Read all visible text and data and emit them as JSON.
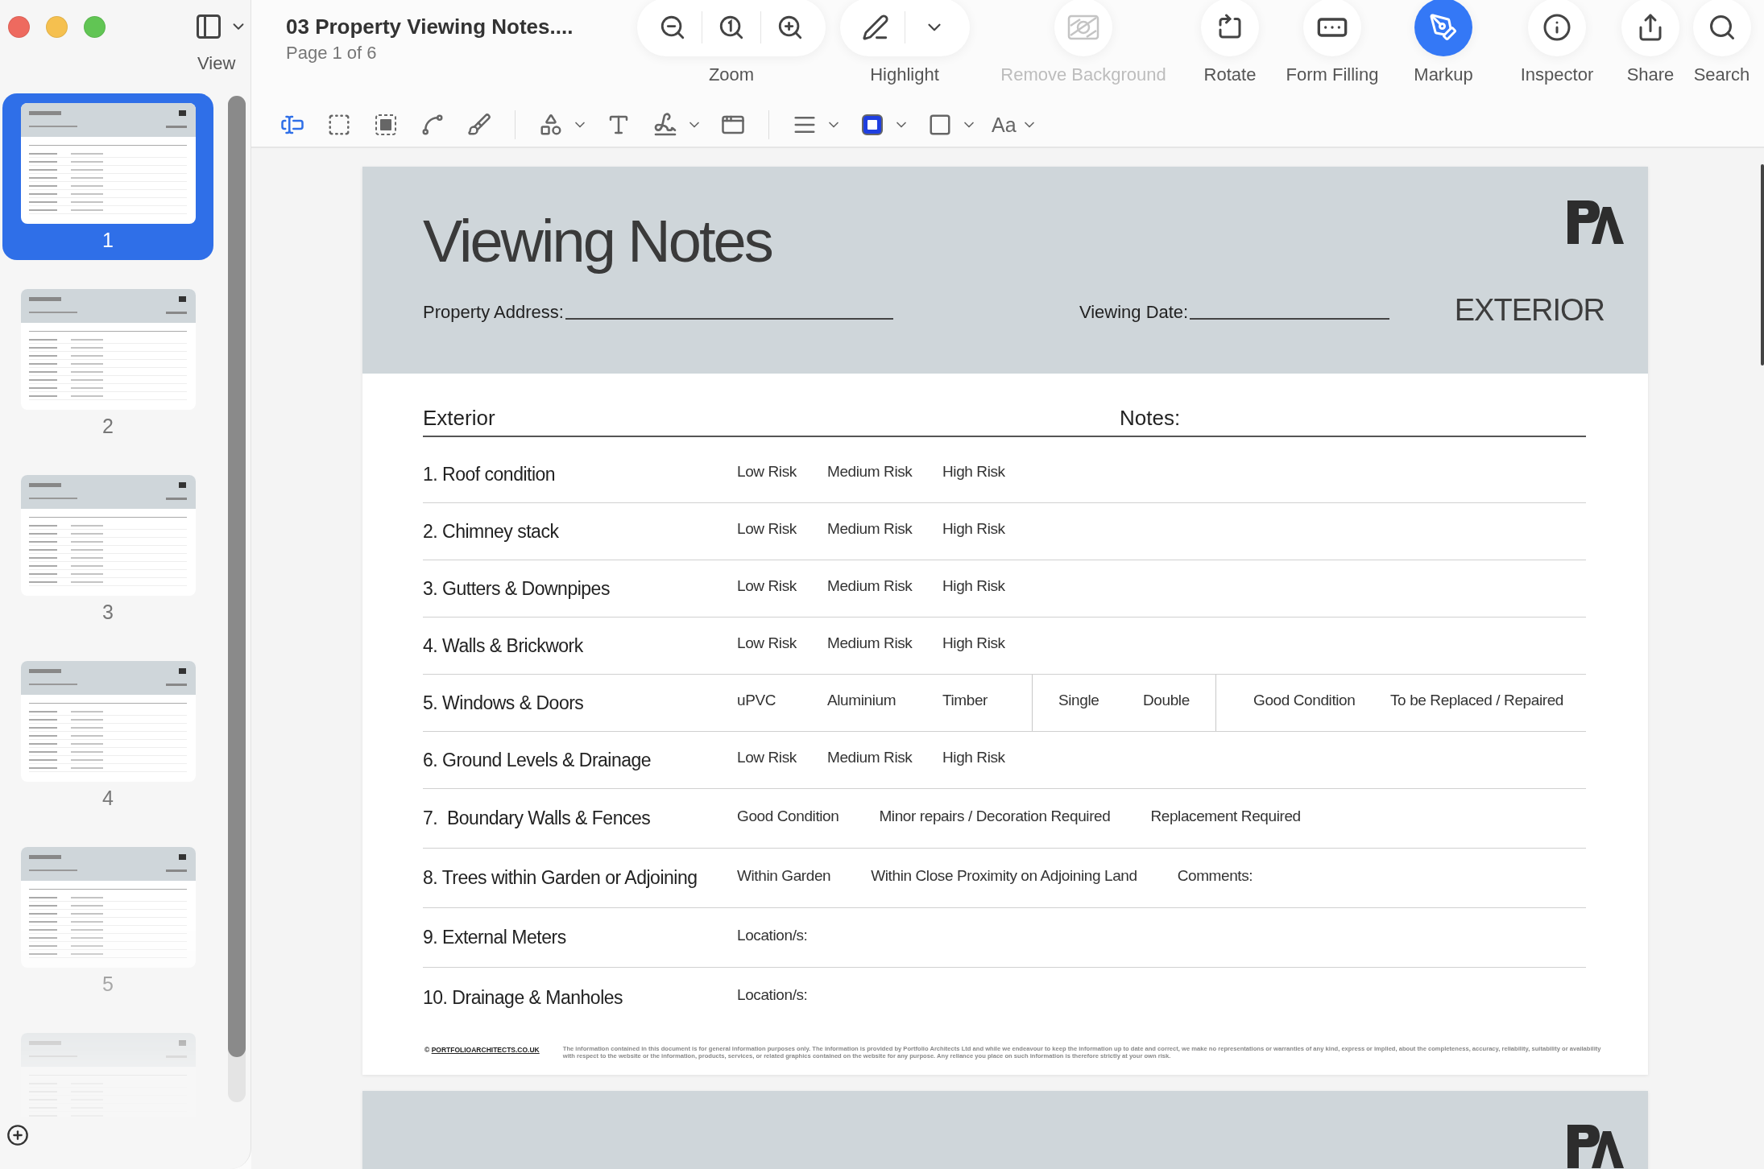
{
  "window": {
    "title": "03 Property Viewing Notes....",
    "subtitle": "Page 1 of 6"
  },
  "sidebar": {
    "view_label": "View",
    "pages": [
      {
        "number": "1",
        "selected": true
      },
      {
        "number": "2",
        "selected": false
      },
      {
        "number": "3",
        "selected": false
      },
      {
        "number": "4",
        "selected": false
      },
      {
        "number": "5",
        "selected": false
      },
      {
        "selected": false
      }
    ]
  },
  "toolbar": [
    {
      "kind": "zoom",
      "label": "Zoom"
    },
    {
      "kind": "highlight",
      "label": "Highlight"
    },
    {
      "kind": "remove-background",
      "label": "Remove Background",
      "selected": false,
      "disabled": true
    },
    {
      "kind": "rotate",
      "label": "Rotate",
      "selected": false,
      "disabled": false
    },
    {
      "kind": "form-filling",
      "label": "Form Filling",
      "selected": false,
      "disabled": false
    },
    {
      "kind": "markup",
      "label": "Markup",
      "selected": true,
      "disabled": false
    },
    {
      "kind": "inspector",
      "label": "Inspector",
      "selected": false,
      "disabled": false
    },
    {
      "kind": "share",
      "label": "Share",
      "selected": false,
      "disabled": false
    },
    {
      "kind": "search",
      "label": "Search",
      "selected": false,
      "disabled": false
    }
  ],
  "markup_tools": [
    {
      "kind": "text-select",
      "selected": true
    },
    {
      "kind": "rect-select",
      "selected": false
    },
    {
      "kind": "lasso",
      "selected": false
    },
    {
      "kind": "sketch",
      "selected": false
    },
    {
      "kind": "draw",
      "selected": false
    },
    {
      "kind": "divider"
    },
    {
      "kind": "shapes",
      "selected": false,
      "menu": true
    },
    {
      "kind": "text-box",
      "selected": false
    },
    {
      "kind": "sign",
      "selected": false,
      "menu": true
    },
    {
      "kind": "note",
      "selected": false
    },
    {
      "kind": "divider"
    },
    {
      "kind": "line-style",
      "selected": false,
      "menu": true
    },
    {
      "kind": "border-color",
      "selected": false,
      "menu": true
    },
    {
      "kind": "fill-color",
      "selected": false,
      "menu": true
    },
    {
      "kind": "text-style",
      "label": "Aa",
      "selected": false,
      "menu": true
    }
  ],
  "document": {
    "pages": [
      {
        "title": "Viewing Notes",
        "address_label": "Property Address:",
        "date_label": "Viewing Date:",
        "section": "EXTERIOR",
        "table": {
          "heading": "Exterior",
          "notes_heading": "Notes:",
          "rows": [
            {
              "label": "1. Roof condition",
              "kind": "grid",
              "groups": [
                [
                  "Low Risk",
                  "Medium Risk",
                  "High Risk"
                ]
              ]
            },
            {
              "label": "2. Chimney stack",
              "kind": "grid",
              "groups": [
                [
                  "Low Risk",
                  "Medium Risk",
                  "High Risk"
                ]
              ]
            },
            {
              "label": "3. Gutters & Downpipes",
              "kind": "grid",
              "groups": [
                [
                  "Low Risk",
                  "Medium Risk",
                  "High Risk"
                ]
              ]
            },
            {
              "label": "4. Walls & Brickwork",
              "kind": "grid",
              "groups": [
                [
                  "Low Risk",
                  "Medium Risk",
                  "High Risk"
                ]
              ]
            },
            {
              "label": "5. Windows & Doors",
              "kind": "grid",
              "groups": [
                [
                  "uPVC",
                  "Aluminium",
                  "Timber"
                ],
                [
                  "Single",
                  "Double"
                ],
                [
                  "Good Condition",
                  "To be Replaced / Repaired"
                ]
              ]
            },
            {
              "label": "6. Ground Levels & Drainage",
              "kind": "grid",
              "groups": [
                [
                  "Low Risk",
                  "Medium Risk",
                  "High Risk"
                ]
              ]
            },
            {
              "label": "7.  Boundary Walls & Fences",
              "kind": "free",
              "groups": [
                [
                  "Good Condition",
                  "Minor repairs / Decoration Required",
                  "Replacement Required"
                ]
              ]
            },
            {
              "label": "8. Trees within Garden or Adjoining",
              "kind": "free",
              "groups": [
                [
                  "Within Garden",
                  "Within Close Proximity on Adjoining Land",
                  "Comments:"
                ]
              ]
            },
            {
              "label": "9. External Meters",
              "kind": "free",
              "groups": [
                [
                  "Location/s:"
                ]
              ]
            },
            {
              "label": "10. Drainage & Manholes",
              "kind": "free",
              "groups": [
                [
                  "Location/s:"
                ]
              ]
            }
          ]
        },
        "footer": {
          "copyright": "©",
          "link": "PORTFOLIOARCHITECTS.CO.UK",
          "disclaimer": "The information contained in this document is for general information purposes only. The information is provided by Portfolio Architects Ltd and while we endeavour to keep the information up to date and correct, we make no representations or warranties of any kind, express or implied, about the completeness, accuracy, reliability, suitability or availability with respect to the website or the information, products, services, or related graphics contained on the website for any purpose. Any reliance you place on such information is therefore strictly at your own risk."
        }
      },
      {
        "kind": "page"
      }
    ]
  }
}
